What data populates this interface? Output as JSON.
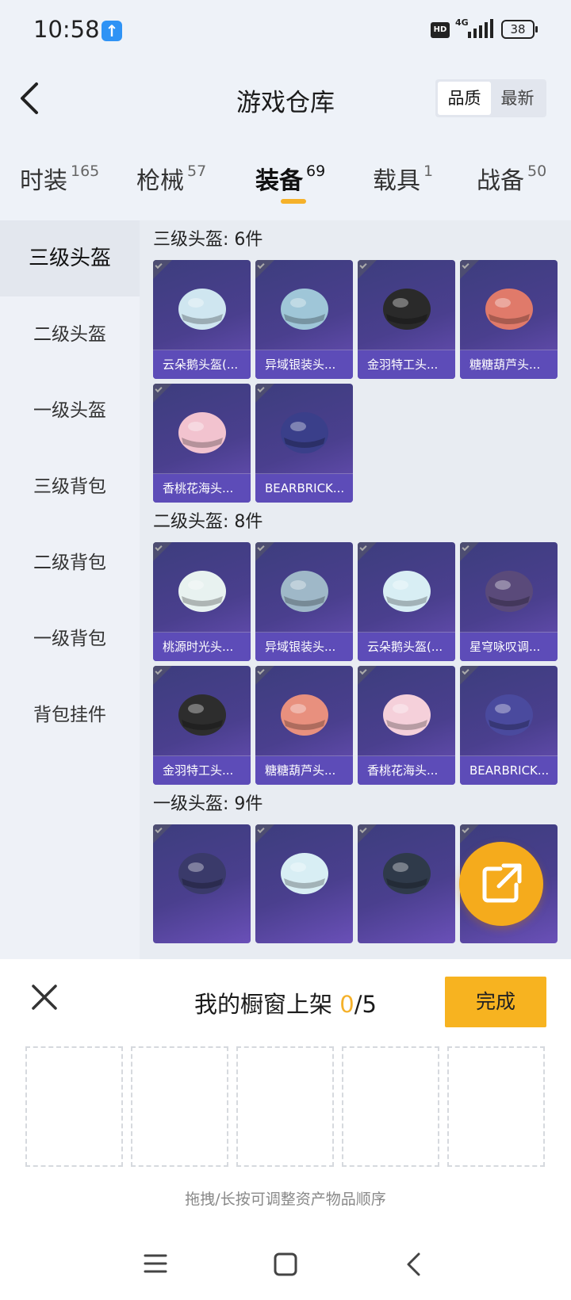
{
  "status": {
    "time": "10:58",
    "network": "4G",
    "battery": "38"
  },
  "header": {
    "title": "游戏仓库",
    "sort": [
      "品质",
      "最新"
    ]
  },
  "tabs": [
    {
      "label": "时装",
      "count": "165"
    },
    {
      "label": "枪械",
      "count": "57"
    },
    {
      "label": "装备",
      "count": "69"
    },
    {
      "label": "载具",
      "count": "1"
    },
    {
      "label": "战备",
      "count": "50"
    }
  ],
  "sidebar": [
    "三级头盔",
    "二级头盔",
    "一级头盔",
    "三级背包",
    "二级背包",
    "一级背包",
    "背包挂件"
  ],
  "sections": [
    {
      "title": "三级头盔: 6件",
      "items": [
        "云朵鹅头盔(...",
        "异域银装头...",
        "金羽特工头...",
        "糖糖葫芦头...",
        "香桃花海头...",
        "BEARBRICK..."
      ]
    },
    {
      "title": "二级头盔: 8件",
      "items": [
        "桃源时光头...",
        "异域银装头...",
        "云朵鹅头盔(...",
        "星穹咏叹调...",
        "金羽特工头...",
        "糖糖葫芦头...",
        "香桃花海头...",
        "BEARBRICK..."
      ]
    },
    {
      "title": "一级头盔: 9件",
      "items": []
    }
  ],
  "sheet": {
    "title_prefix": "我的橱窗上架 ",
    "count": "0",
    "total": "/5",
    "done": "完成",
    "hint": "拖拽/长按可调整资产物品顺序"
  }
}
